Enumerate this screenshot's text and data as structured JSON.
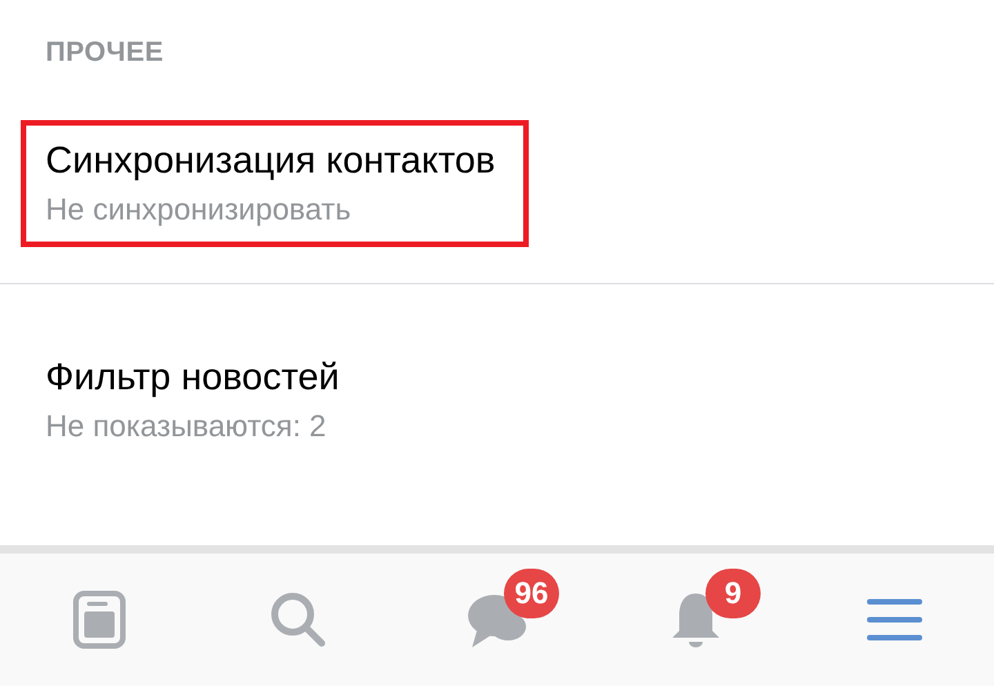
{
  "section": {
    "title": "ПРОЧЕЕ"
  },
  "items": [
    {
      "title": "Синхронизация контактов",
      "subtitle": "Не синхронизировать",
      "highlighted": true
    },
    {
      "title": "Фильтр новостей",
      "subtitle": "Не показываются: 2",
      "highlighted": false
    }
  ],
  "nav": [
    {
      "kind": "news",
      "selected": false
    },
    {
      "kind": "search",
      "selected": false
    },
    {
      "kind": "messages",
      "selected": false,
      "badge": "96"
    },
    {
      "kind": "notifications",
      "selected": false,
      "badge": "9"
    },
    {
      "kind": "menu",
      "selected": true
    }
  ]
}
